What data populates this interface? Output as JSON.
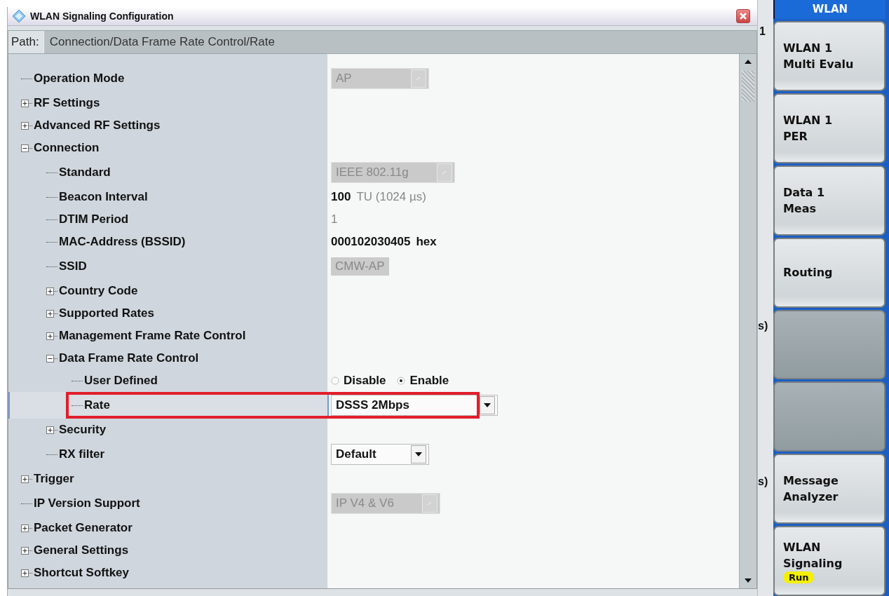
{
  "window": {
    "title": "WLAN Signaling Configuration"
  },
  "path": {
    "label": "Path:",
    "value": "Connection/Data Frame Rate Control/Rate"
  },
  "tree": [
    {
      "label": "Operation Mode",
      "selected": false,
      "highlighted": false,
      "control": {
        "kind": "dropdown",
        "value": "AP",
        "disabled": true
      }
    },
    {
      "label": "RF Settings",
      "selected": false,
      "highlighted": false,
      "expanded": false
    },
    {
      "label": "Advanced RF Settings",
      "selected": false,
      "highlighted": false,
      "expanded": false
    },
    {
      "label": "Connection",
      "selected": false,
      "highlighted": false,
      "expanded": true,
      "children": [
        {
          "label": "Standard",
          "selected": false,
          "highlighted": false,
          "control": {
            "kind": "dropdown",
            "value": "IEEE 802.11g",
            "disabled": true
          }
        },
        {
          "label": "Beacon Interval",
          "selected": false,
          "highlighted": false,
          "control": {
            "kind": "text",
            "value": "100",
            "disabled": false,
            "unit": "TU (1024 µs)",
            "unit_disabled": true
          }
        },
        {
          "label": "DTIM Period",
          "selected": false,
          "highlighted": false,
          "control": {
            "kind": "text",
            "value": "1",
            "disabled": true
          }
        },
        {
          "label": "MAC-Address (BSSID)",
          "selected": false,
          "highlighted": false,
          "control": {
            "kind": "text",
            "value": "000102030405",
            "disabled": false,
            "unit": "hex",
            "unit_disabled": false
          }
        },
        {
          "label": "SSID",
          "selected": false,
          "highlighted": false,
          "control": {
            "kind": "field",
            "value": "CMW-AP",
            "disabled": true
          }
        },
        {
          "label": "Country Code",
          "selected": false,
          "highlighted": false,
          "expanded": false
        },
        {
          "label": "Supported Rates",
          "selected": false,
          "highlighted": false,
          "expanded": false
        },
        {
          "label": "Management Frame Rate Control",
          "selected": false,
          "highlighted": false,
          "expanded": false
        },
        {
          "label": "Data Frame Rate Control",
          "selected": false,
          "highlighted": false,
          "expanded": true,
          "children": [
            {
              "label": "User Defined",
              "selected": false,
              "highlighted": false,
              "control": {
                "kind": "radio",
                "options": [
                  {
                    "label": "Disable",
                    "selected": false
                  },
                  {
                    "label": "Enable",
                    "selected": true
                  }
                ]
              }
            },
            {
              "label": "Rate",
              "selected": true,
              "highlighted": true,
              "control": {
                "kind": "dropdown",
                "value": "DSSS 2Mbps",
                "disabled": false
              }
            }
          ]
        },
        {
          "label": "Security",
          "selected": false,
          "highlighted": false,
          "expanded": false
        },
        {
          "label": "RX filter",
          "selected": false,
          "highlighted": false,
          "control": {
            "kind": "dropdown",
            "value": "Default",
            "disabled": false
          }
        }
      ]
    },
    {
      "label": "Trigger",
      "selected": false,
      "highlighted": false,
      "expanded": false
    },
    {
      "label": "IP Version Support",
      "selected": false,
      "highlighted": false,
      "control": {
        "kind": "dropdown",
        "value": "IP V4 & V6",
        "disabled": true
      }
    },
    {
      "label": "Packet Generator",
      "selected": false,
      "highlighted": false,
      "expanded": false
    },
    {
      "label": "General Settings",
      "selected": false,
      "highlighted": false,
      "expanded": false
    },
    {
      "label": "Shortcut Softkey",
      "selected": false,
      "highlighted": false,
      "expanded": false
    }
  ],
  "side_strip": [
    "1",
    "s)",
    "s)"
  ],
  "softkeys": {
    "header": "WLAN",
    "keys": [
      {
        "kind": "label",
        "lines": [
          "WLAN 1",
          "Multi Evalu"
        ]
      },
      {
        "kind": "label",
        "lines": [
          "WLAN 1",
          "PER"
        ]
      },
      {
        "kind": "label",
        "lines": [
          "Data 1",
          "Meas"
        ]
      },
      {
        "kind": "label",
        "lines": [
          "Routing"
        ]
      },
      {
        "kind": "blank"
      },
      {
        "kind": "blank"
      },
      {
        "kind": "label",
        "lines": [
          "Message",
          "Analyzer"
        ]
      },
      {
        "kind": "label",
        "lines": [
          "WLAN",
          "Signaling"
        ],
        "badge": "Run"
      }
    ]
  }
}
